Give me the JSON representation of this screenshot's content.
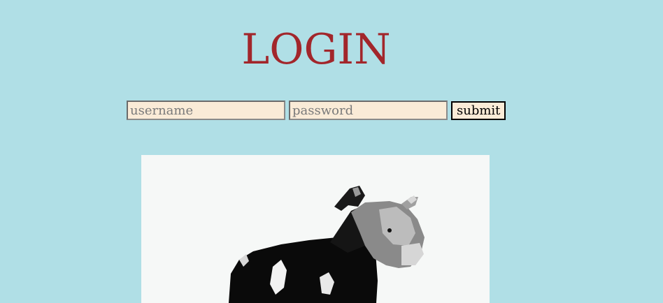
{
  "page": {
    "title": "LOGIN"
  },
  "form": {
    "username_placeholder": "username",
    "username_value": "",
    "password_placeholder": "password",
    "password_value": "",
    "submit_label": "submit"
  },
  "colors": {
    "background": "#b0dfe6",
    "title": "#a2262b",
    "input_background": "#faebd7"
  },
  "image": {
    "subject": "cow-image"
  }
}
